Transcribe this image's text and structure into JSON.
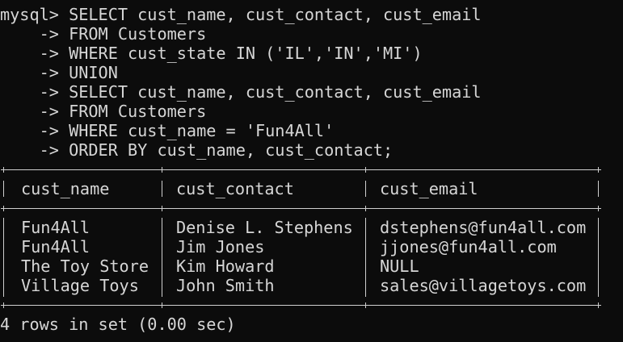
{
  "terminal": {
    "command_lines": [
      "mysql> SELECT cust_name, cust_contact, cust_email",
      "    -> FROM Customers",
      "    -> WHERE cust_state IN ('IL','IN','MI')",
      "    -> UNION",
      "    -> SELECT cust_name, cust_contact, cust_email",
      "    -> FROM Customers",
      "    -> WHERE cust_name = 'Fun4All'",
      "    -> ORDER BY cust_name, cust_contact;"
    ],
    "result_table": {
      "columns": [
        "cust_name",
        "cust_contact",
        "cust_email"
      ],
      "rows": [
        [
          "Fun4All",
          "Denise L. Stephens",
          "dstephens@fun4all.com"
        ],
        [
          "Fun4All",
          "Jim Jones",
          "jjones@fun4all.com"
        ],
        [
          "The Toy Store",
          "Kim Howard",
          "NULL"
        ],
        [
          "Village Toys",
          "John Smith",
          "sales@villagetoys.com"
        ]
      ]
    },
    "status_line": "4 rows in set (0.00 sec)",
    "colors": {
      "background": "#0c0c0c",
      "foreground": "#d6d6d6"
    }
  }
}
